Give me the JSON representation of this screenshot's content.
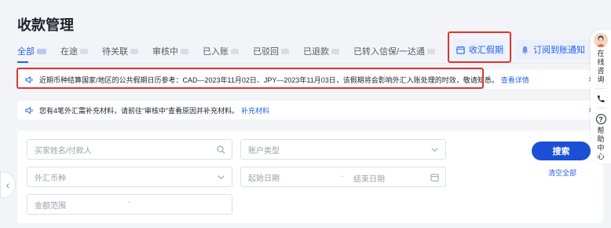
{
  "page": {
    "title": "收款管理"
  },
  "tabs": [
    {
      "label": "全部",
      "active": true
    },
    {
      "label": "在途"
    },
    {
      "label": "待关联"
    },
    {
      "label": "审核中"
    },
    {
      "label": "已入账"
    },
    {
      "label": "已驳回"
    },
    {
      "label": "已退款"
    },
    {
      "label": "已转入信保/一达通"
    }
  ],
  "actions": {
    "holiday_label": "收汇假期",
    "notify_label": "订阅到账通知"
  },
  "notices": [
    {
      "text": "近期币种结算国家/地区的公共假期日历参考：CAD—2023年11月02日、JPY—2023年11月03日，该假期将会影响外汇入账处理的时效，敬请知悉。",
      "link": "查看详情"
    },
    {
      "text": "您有4笔外汇需补充材料，请前往“审核中”查看原因并补充材料。",
      "link": "补充材料"
    }
  ],
  "filters": {
    "buyer_placeholder": "买家姓名/付款人",
    "account_type_placeholder": "账户类型",
    "currency_placeholder": "外汇币种",
    "start_date_placeholder": "起始日期",
    "date_separator": "-",
    "end_date_placeholder": "结束日期",
    "amount_placeholder": "金额范围",
    "amount_separator": "-",
    "search_label": "搜索",
    "clear_label": "清空全部"
  },
  "side_panel": {
    "online_consult": "在线咨询",
    "help_center": "帮助中心"
  },
  "icons": {
    "close": "×",
    "left_arrow": "‹",
    "help": "?"
  },
  "colors": {
    "accent": "#2a62e8",
    "primary_button": "#1a4fd6",
    "highlight_box": "#e0342d"
  }
}
